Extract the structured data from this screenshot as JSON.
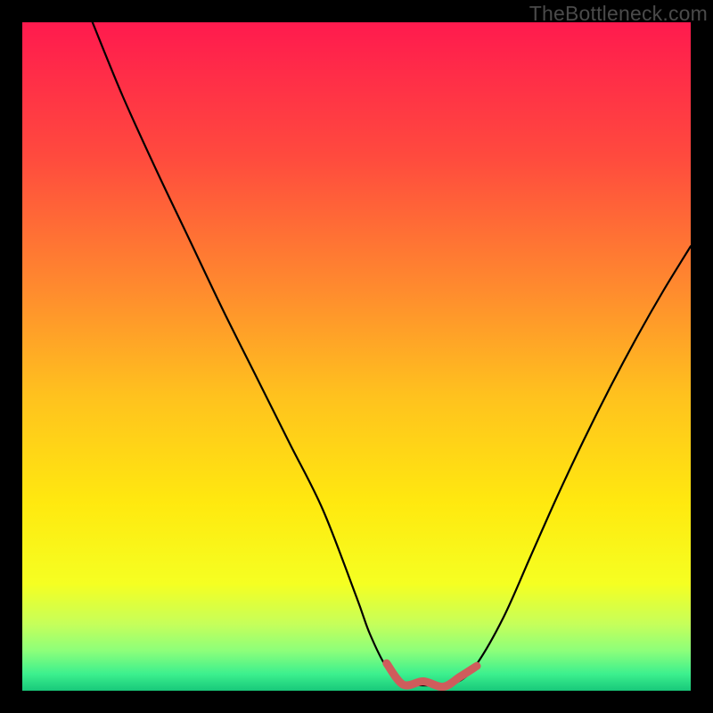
{
  "watermark": {
    "text": "TheBottleneck.com"
  },
  "chart_data": {
    "type": "line",
    "title": "",
    "xlabel": "",
    "ylabel": "",
    "xlim": [
      0,
      100
    ],
    "ylim": [
      0,
      100
    ],
    "legend": false,
    "grid": false,
    "background_gradient": [
      {
        "offset": 0,
        "color": "#ff1a4e"
      },
      {
        "offset": 0.2,
        "color": "#ff4a3e"
      },
      {
        "offset": 0.4,
        "color": "#ff8b2e"
      },
      {
        "offset": 0.56,
        "color": "#ffc21e"
      },
      {
        "offset": 0.72,
        "color": "#ffe90f"
      },
      {
        "offset": 0.84,
        "color": "#f5ff22"
      },
      {
        "offset": 0.9,
        "color": "#c6ff5a"
      },
      {
        "offset": 0.94,
        "color": "#8dff7a"
      },
      {
        "offset": 0.975,
        "color": "#3cf08e"
      },
      {
        "offset": 1.0,
        "color": "#18c87a"
      }
    ],
    "series": [
      {
        "name": "bottleneck-curve",
        "x": [
          10.5,
          15,
          20,
          25,
          30,
          35,
          40,
          45,
          50,
          52,
          54.5,
          57,
          60,
          63,
          65.5,
          68,
          72,
          76,
          80,
          84,
          88,
          92,
          96,
          100
        ],
        "y": [
          100,
          89,
          78,
          67.5,
          57,
          47,
          37,
          27,
          14,
          8.5,
          3.5,
          1.2,
          0.8,
          0.9,
          1.5,
          4,
          11,
          20,
          29,
          37.5,
          45.5,
          53,
          60,
          66.5
        ]
      }
    ],
    "highlight": {
      "name": "sweet-spot",
      "xrange": [
        54,
        68
      ],
      "color": "#cf5c5c",
      "stroke_width": 9
    }
  }
}
